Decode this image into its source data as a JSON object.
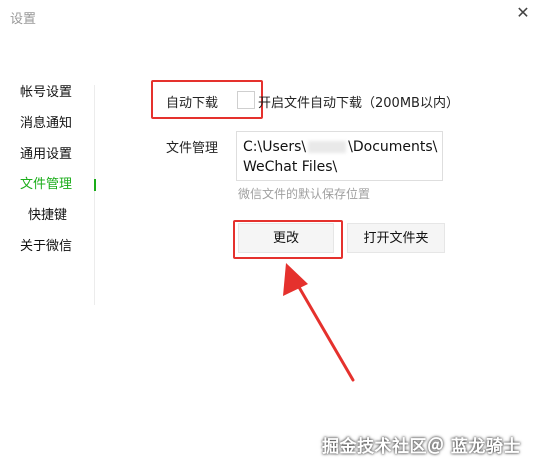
{
  "window": {
    "title": "设置",
    "close_glyph": "✕"
  },
  "sidebar": {
    "items": [
      {
        "label": "帐号设置"
      },
      {
        "label": "消息通知"
      },
      {
        "label": "通用设置"
      },
      {
        "label": "文件管理",
        "active": true
      },
      {
        "label": "快捷键"
      },
      {
        "label": "关于微信"
      }
    ]
  },
  "auto_download": {
    "label": "自动下载",
    "checkbox_text": "开启文件自动下载（200MB以内）",
    "checked": false
  },
  "file_management": {
    "label": "文件管理",
    "path_line1_prefix": "C:\\Users\\",
    "path_line1_suffix": "\\Documents\\",
    "path_line2": "WeChat Files\\",
    "hint": "微信文件的默认保存位置"
  },
  "buttons": {
    "change": "更改",
    "open_folder": "打开文件夹"
  },
  "colors": {
    "accent": "#1aad19",
    "annotation": "#e5312d"
  },
  "watermark": "掘金技术社区＠ 蓝龙骑士"
}
